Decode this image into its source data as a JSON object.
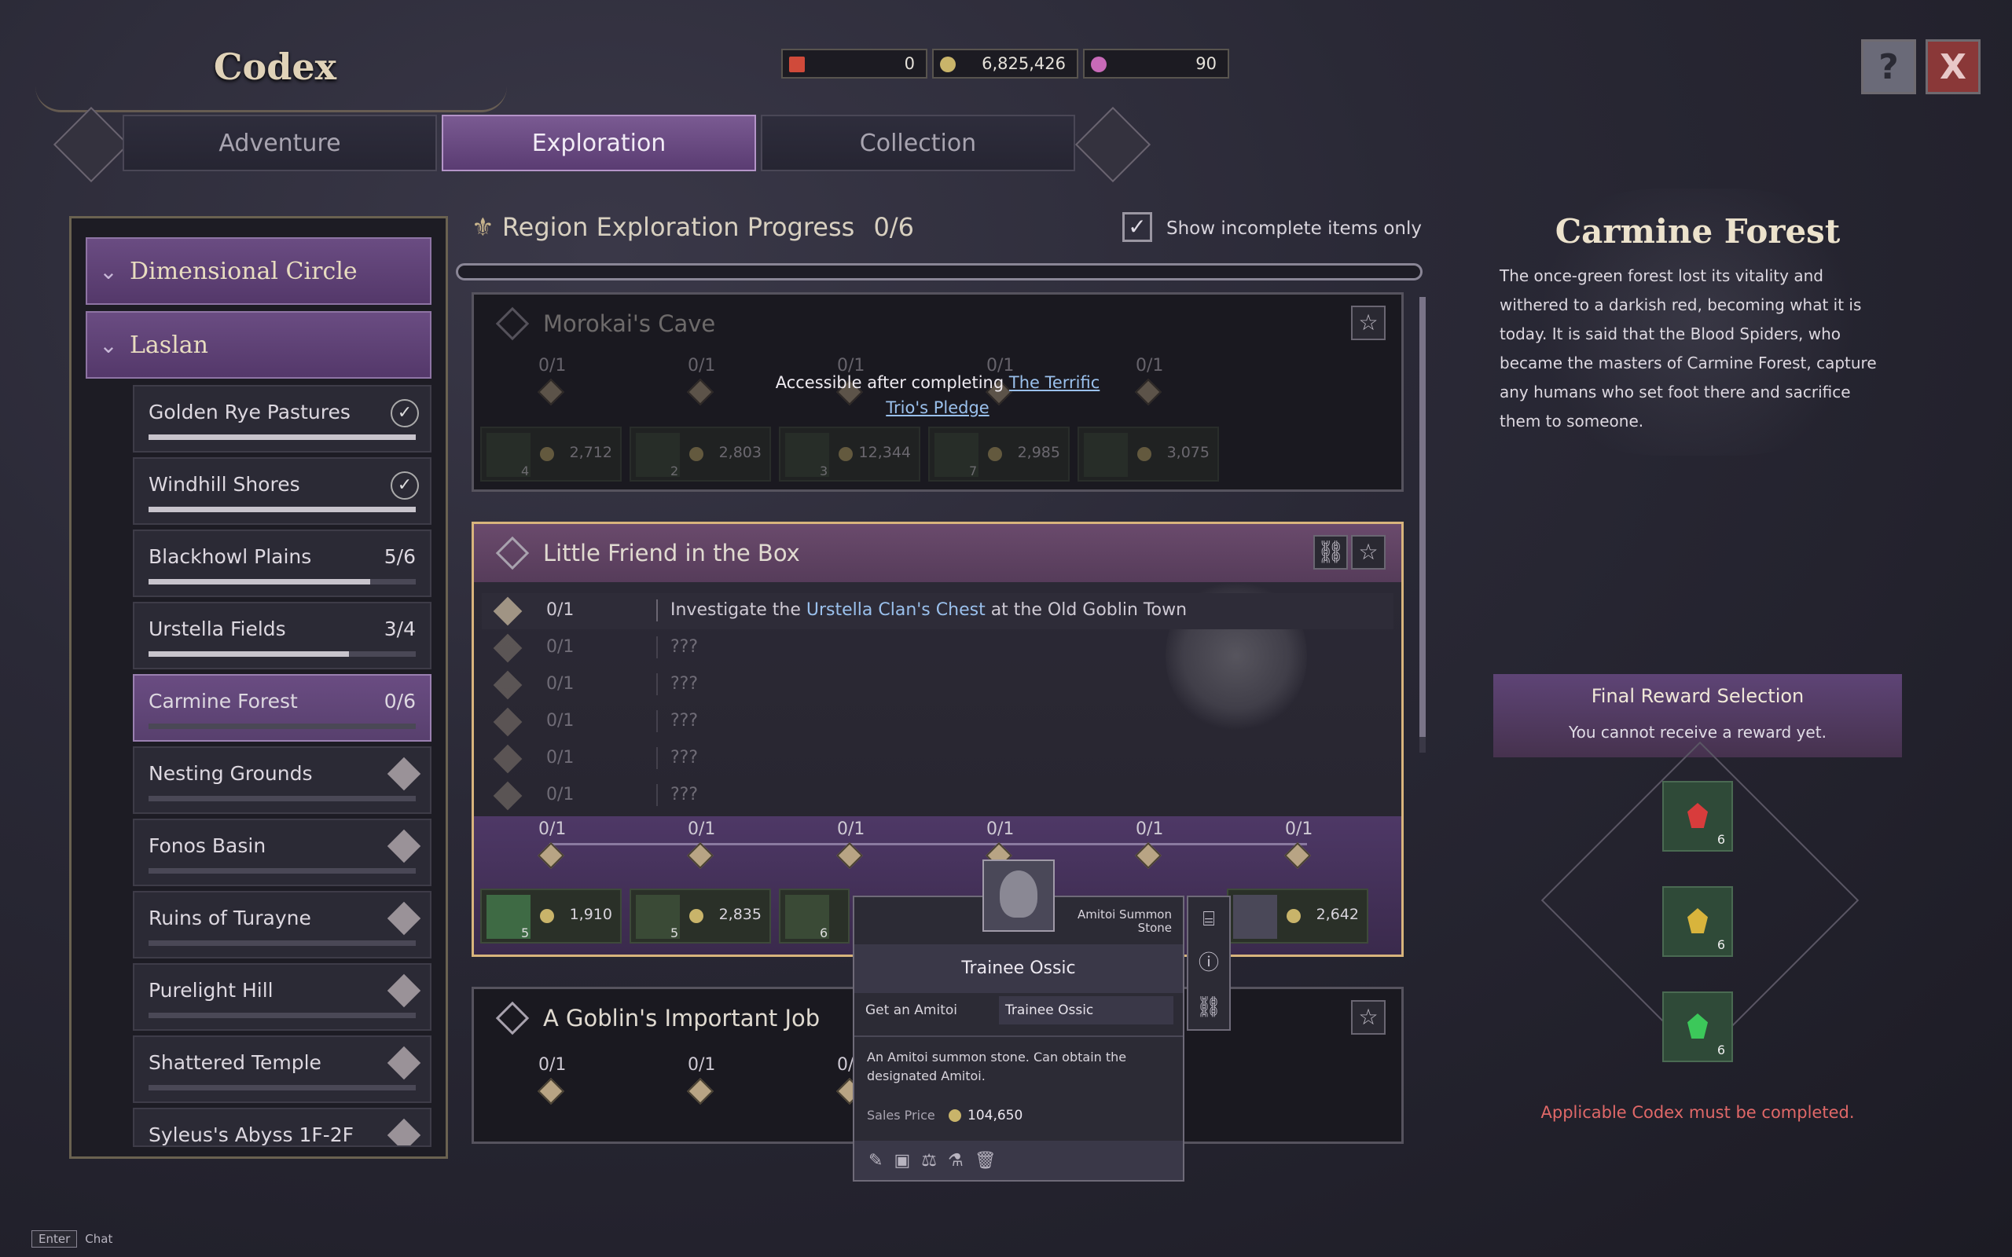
{
  "header": {
    "title": "Codex",
    "currencies": [
      {
        "icon": "flag-token-icon",
        "value": "0",
        "color": "#d04a3a"
      },
      {
        "icon": "gold-coin-icon",
        "value": "6,825,426",
        "color": "#c9b46a"
      },
      {
        "icon": "pink-gem-icon",
        "value": "90",
        "color": "#c86ab8"
      }
    ],
    "help_label": "?",
    "close_label": "X"
  },
  "tabs": [
    {
      "label": "Adventure",
      "active": false
    },
    {
      "label": "Exploration",
      "active": true
    },
    {
      "label": "Collection",
      "active": false
    }
  ],
  "sidebar": {
    "categories": [
      {
        "label": "Dimensional Circle"
      },
      {
        "label": "Laslan"
      }
    ],
    "regions": [
      {
        "label": "Golden Rye Pastures",
        "progress": "",
        "fill": 1.0,
        "status": "complete"
      },
      {
        "label": "Windhill Shores",
        "progress": "",
        "fill": 1.0,
        "status": "complete"
      },
      {
        "label": "Blackhowl Plains",
        "progress": "5/6",
        "fill": 0.83,
        "status": "progress"
      },
      {
        "label": "Urstella Fields",
        "progress": "3/4",
        "fill": 0.75,
        "status": "progress"
      },
      {
        "label": "Carmine Forest",
        "progress": "0/6",
        "fill": 0,
        "status": "selected"
      },
      {
        "label": "Nesting Grounds",
        "progress": "",
        "fill": 0,
        "status": "locked"
      },
      {
        "label": "Fonos Basin",
        "progress": "",
        "fill": 0,
        "status": "locked"
      },
      {
        "label": "Ruins of Turayne",
        "progress": "",
        "fill": 0,
        "status": "locked"
      },
      {
        "label": "Purelight Hill",
        "progress": "",
        "fill": 0,
        "status": "locked"
      },
      {
        "label": "Shattered Temple",
        "progress": "",
        "fill": 0,
        "status": "locked"
      },
      {
        "label": "Syleus's Abyss 1F-2F",
        "progress": "",
        "fill": 0,
        "status": "locked"
      }
    ]
  },
  "center": {
    "progress_label": "Region Exploration Progress",
    "progress_value": "0/6",
    "filter_label": "Show incomplete items only",
    "filter_checked": true,
    "card1": {
      "title": "Morokai's Cave",
      "locked_prefix": "Accessible after completing",
      "locked_link": "The Terrific Trio's Pledge",
      "nodes": [
        "0/1",
        "0/1",
        "0/1",
        "0/1",
        "0/1"
      ],
      "rewards": [
        {
          "count": "4",
          "value": "2,712"
        },
        {
          "count": "2",
          "value": "2,803"
        },
        {
          "count": "3",
          "value": "12,344"
        },
        {
          "count": "7",
          "value": "2,985"
        },
        {
          "count": "",
          "value": "3,075"
        }
      ]
    },
    "card2": {
      "title": "Little Friend in the Box",
      "rows": [
        {
          "progress": "0/1",
          "pre": "Investigate the ",
          "link": "Urstella Clan's Chest",
          "post": " at the Old Goblin Town"
        },
        {
          "progress": "0/1",
          "pre": "???",
          "link": "",
          "post": ""
        },
        {
          "progress": "0/1",
          "pre": "???",
          "link": "",
          "post": ""
        },
        {
          "progress": "0/1",
          "pre": "???",
          "link": "",
          "post": ""
        },
        {
          "progress": "0/1",
          "pre": "???",
          "link": "",
          "post": ""
        },
        {
          "progress": "0/1",
          "pre": "???",
          "link": "",
          "post": ""
        }
      ],
      "nodes": [
        "0/1",
        "0/1",
        "0/1",
        "0/1",
        "0/1",
        "0/1"
      ],
      "rewards": [
        {
          "count": "5",
          "value": "1,910"
        },
        {
          "count": "5",
          "value": "2,835"
        },
        {
          "count": "6",
          "value": ""
        },
        {
          "count": "",
          "value": "2,642"
        }
      ]
    },
    "card3": {
      "title": "A Goblin's Important Job",
      "nodes": [
        "0/1",
        "0/1",
        "0/"
      ]
    }
  },
  "tooltip": {
    "category": "Amitoi Summon Stone",
    "name": "Trainee Ossic",
    "field_label": "Get an Amitoi",
    "field_value": "Trainee Ossic",
    "description": "An Amitoi summon stone. Can obtain the designated Amitoi.",
    "price_label": "Sales Price",
    "price_value": "104,650",
    "actions": [
      "feather-icon",
      "box-icon",
      "scale-icon",
      "flask-icon",
      "trash-icon"
    ]
  },
  "right_panel": {
    "title": "Carmine Forest",
    "description": "The once-green forest lost its vitality and withered to a darkish red, becoming what it is today. It is said that the Blood Spiders, who became the masters of Carmine Forest, capture any humans who set foot there and sacrifice them to someone.",
    "reward_title": "Final Reward Selection",
    "reward_subtitle": "You cannot receive a reward yet.",
    "gems": [
      {
        "color": "#d83c3c",
        "count": "6"
      },
      {
        "color": "#d8b43c",
        "count": "6"
      },
      {
        "color": "#3cc85a",
        "count": "6"
      }
    ],
    "warning": "Applicable Codex must be completed.",
    "warning_color": "#e06868"
  },
  "footer": {
    "key": "Enter",
    "label": "Chat"
  }
}
